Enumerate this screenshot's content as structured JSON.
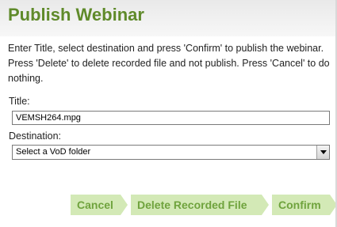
{
  "dialog": {
    "title": "Publish Webinar",
    "instructions": "Enter Title, select destination and press 'Confirm' to publish the webinar. Press 'Delete' to delete recorded file and not publish. Press 'Cancel' to do nothing."
  },
  "form": {
    "title_label": "Title:",
    "title_value": "VEMSH264.mpg",
    "destination_label": "Destination:",
    "destination_selected": "Select a VoD folder"
  },
  "buttons": {
    "cancel": "Cancel",
    "delete": "Delete Recorded File",
    "confirm": "Confirm"
  },
  "colors": {
    "title": "#5f8a2a",
    "button_bg": "#d3e9b6",
    "button_text": "#6fa33d"
  },
  "icons": {
    "select_arrow": "chevron-down-icon"
  }
}
